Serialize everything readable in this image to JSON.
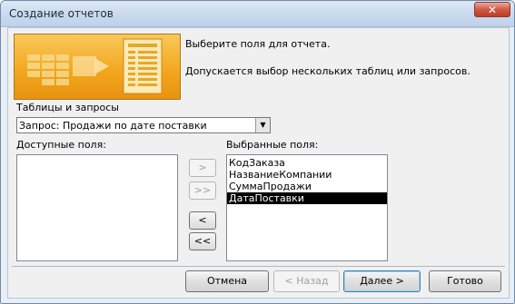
{
  "window": {
    "title": "Создание отчетов",
    "close_glyph": "✕"
  },
  "header": {
    "line1": "Выберите поля для отчета.",
    "line2": "Допускается выбор нескольких таблиц или запросов."
  },
  "source": {
    "label": "Таблицы и запросы",
    "selected": "Запрос: Продажи по дате поставки",
    "arrow_glyph": "▼"
  },
  "available": {
    "label": "Доступные поля:",
    "items": []
  },
  "move_buttons": {
    "add_one": ">",
    "add_all": ">>",
    "remove_one": "<",
    "remove_all": "<<"
  },
  "selected_fields": {
    "label": "Выбранные поля:",
    "items": [
      "КодЗаказа",
      "НазваниеКомпании",
      "СуммаПродажи",
      "ДатаПоставки"
    ],
    "selected_index": 3
  },
  "footer": {
    "cancel": "Отмена",
    "back": "< Назад",
    "next": "Далее >",
    "finish": "Готово"
  },
  "colors": {
    "banner": "#f2a51c",
    "selection": "#000000",
    "title_bar": "#c9d9ee"
  }
}
